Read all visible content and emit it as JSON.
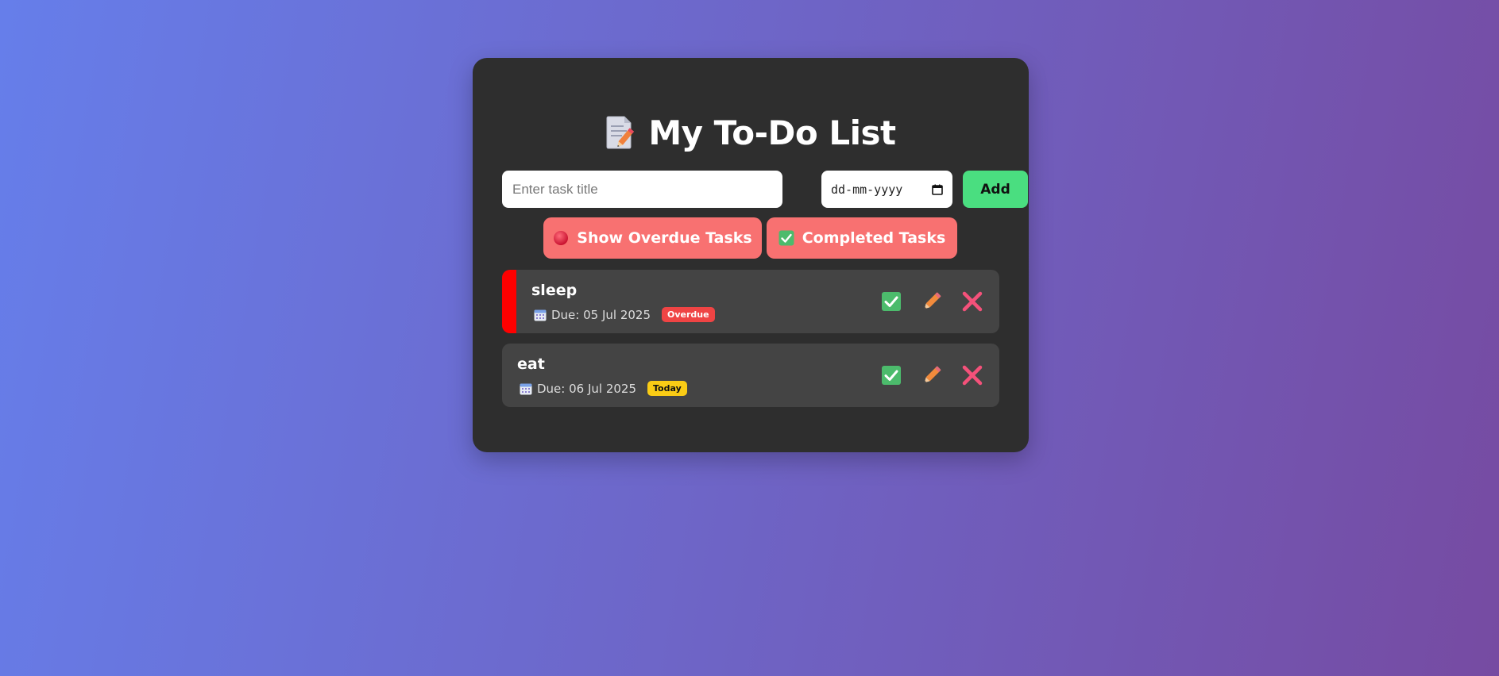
{
  "header": {
    "title": "My To-Do List",
    "title_icon": "memo-icon"
  },
  "form": {
    "task_placeholder": "Enter task title",
    "task_value": "",
    "date_placeholder": "dd-mm-yyyy",
    "add_label": "Add"
  },
  "filters": {
    "overdue_label": "Show Overdue Tasks",
    "overdue_icon": "red-circle-icon",
    "completed_label": "Completed Tasks",
    "completed_icon": "check-mark-button-icon"
  },
  "tasks": [
    {
      "title": "sleep",
      "due": "Due: 05 Jul 2025",
      "badge": "Overdue",
      "badge_color": "#ef4444",
      "indicator_color": "#ff0000"
    },
    {
      "title": "eat",
      "due": "Due: 06 Jul 2025",
      "badge": "Today",
      "badge_color": "#facc15"
    }
  ],
  "colors": {
    "background_start": "#667eea",
    "background_end": "#764ba2",
    "card": "#2e2e2e",
    "task_bg": "#444444",
    "add_button": "#4ade80",
    "filter_button": "#f87171"
  }
}
